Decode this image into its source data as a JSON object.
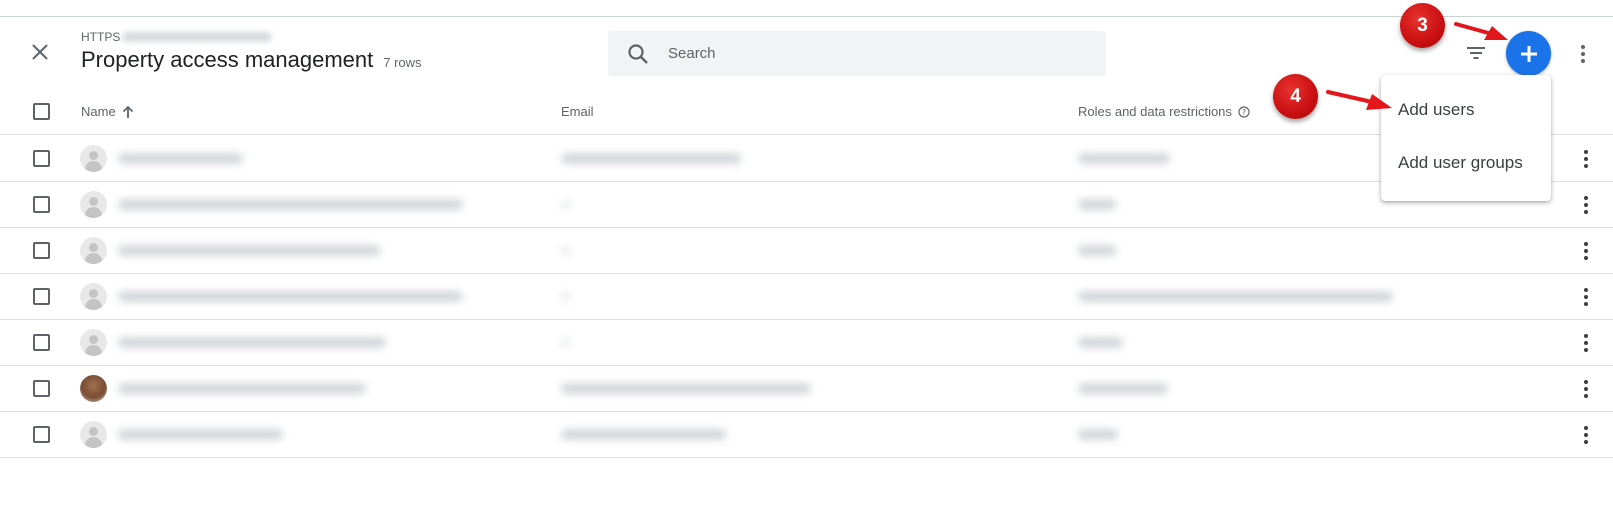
{
  "header": {
    "breadcrumb_prefix": "HTTPS",
    "title": "Property access management",
    "row_count": "7 rows"
  },
  "search": {
    "placeholder": "Search"
  },
  "table": {
    "columns": {
      "name": "Name",
      "email": "Email",
      "roles": "Roles and data restrictions"
    },
    "row_count": 7
  },
  "add_menu": {
    "items": [
      "Add users",
      "Add user groups"
    ]
  },
  "annotations": {
    "step_fab": "3",
    "step_add_users": "4"
  },
  "colors": {
    "fab": "#1a73e8",
    "badge": "#c90f12",
    "arrow": "#e3161b"
  },
  "icons": [
    "close-icon",
    "search-icon",
    "filter-icon",
    "add-icon",
    "more-vert-icon",
    "sort-arrow-up-icon",
    "help-icon",
    "avatar-icon"
  ]
}
